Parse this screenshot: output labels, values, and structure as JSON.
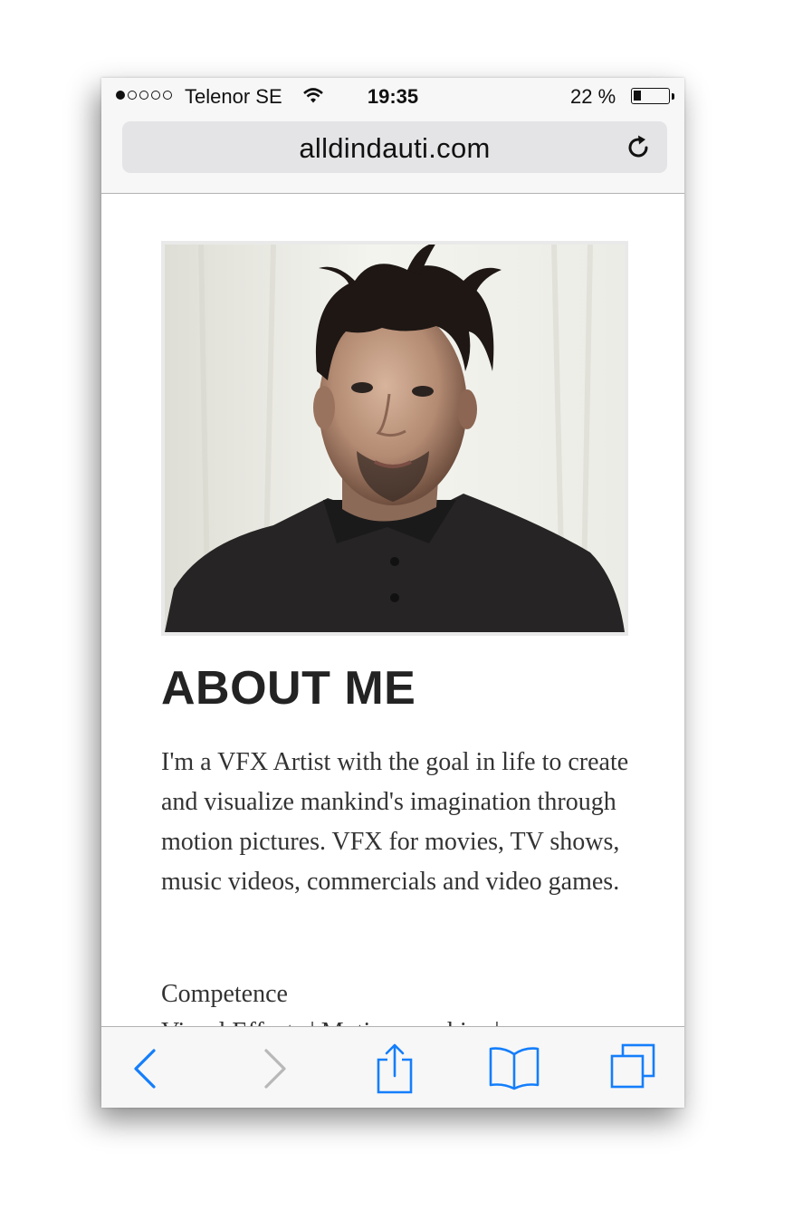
{
  "status_bar": {
    "signal_filled": 1,
    "signal_total": 5,
    "carrier": "Telenor SE",
    "wifi_icon": "wifi-icon",
    "time": "19:35",
    "battery_percent": "22 %",
    "battery_level": 0.22
  },
  "address_bar": {
    "url": "alldindauti.com",
    "reload_icon": "reload-icon"
  },
  "page": {
    "about_title": "ABOUT ME",
    "about_text": "I'm a VFX Artist with the goal in life to create and visualize mankind's imagination through motion pictures. VFX for movies, TV shows, music videos, commercials and video games.",
    "competence_label": "Competence",
    "competence_list": "Visual Effects | Motion graphics |"
  },
  "toolbar": {
    "icons": [
      "back-icon",
      "forward-icon",
      "share-icon",
      "bookmarks-icon",
      "tabs-icon"
    ],
    "accent_color": "#147efb",
    "disabled_color": "#b8b8b8"
  }
}
